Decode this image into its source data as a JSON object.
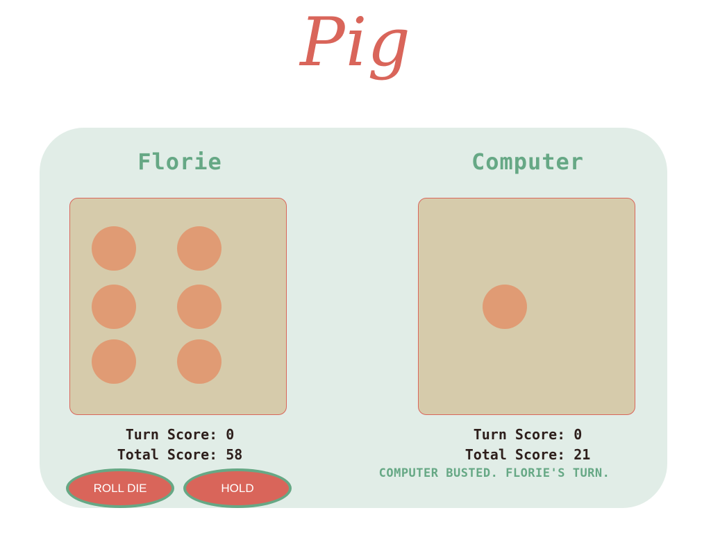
{
  "title": "Pig",
  "players": [
    {
      "name": "Florie",
      "die_value": 6,
      "turn_score_label": "Turn Score: 0",
      "total_score_label": "Total Score: 58",
      "turn_score": 0,
      "total_score": 58
    },
    {
      "name": "Computer",
      "die_value": 1,
      "turn_score_label": "Turn Score: 0",
      "total_score_label": "Total Score: 21",
      "turn_score": 0,
      "total_score": 21
    }
  ],
  "controls": {
    "roll_label": "ROLL DIE",
    "hold_label": "HOLD"
  },
  "status_message": "COMPUTER BUSTED. FLORIE'S TURN.",
  "colors": {
    "accent_red": "#d9655a",
    "accent_green": "#66a885",
    "board_bg": "#e1ede7",
    "die_face": "#d6cbab",
    "pip": "#e09b74"
  }
}
